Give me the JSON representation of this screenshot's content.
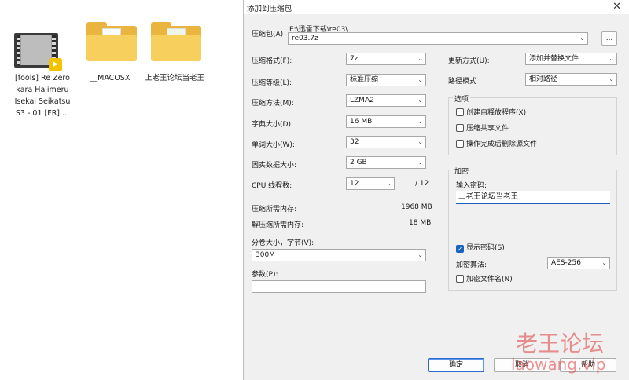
{
  "files": [
    {
      "name": "[fools] Re Zero kara Hajimeru Isekai Seikatsu S3 - 01 [FR] ...",
      "icon": "video-file-icon"
    },
    {
      "name": "__MACOSX",
      "icon": "folder-icon"
    },
    {
      "name": "上老王论坛当老王",
      "icon": "folder-icon"
    }
  ],
  "dialog": {
    "title": "添加到压缩包",
    "archive_label": "压缩包(A)",
    "archive_path": "E:\\迅雷下载\\re03\\",
    "archive_name": "re03.7z",
    "browse_label": "...",
    "left": {
      "format_label": "压缩格式(F):",
      "format_value": "7z",
      "level_label": "压缩等级(L):",
      "level_value": "标准压缩",
      "method_label": "压缩方法(M):",
      "method_value": "LZMA2",
      "dict_label": "字典大小(D):",
      "dict_value": "16 MB",
      "word_label": "单词大小(W):",
      "word_value": "32",
      "solid_label": "固实数据大小:",
      "solid_value": "2 GB",
      "cpu_label": "CPU 线程数:",
      "cpu_value": "12",
      "cpu_total": "/ 12",
      "mem_comp_label": "压缩所需内存:",
      "mem_comp_value": "1968 MB",
      "mem_decomp_label": "解压缩所需内存:",
      "mem_decomp_value": "18 MB",
      "split_label": "分卷大小，字节(V):",
      "split_value": "300M",
      "params_label": "参数(P):",
      "params_value": ""
    },
    "right": {
      "update_label": "更新方式(U):",
      "update_value": "添加并替换文件",
      "path_label": "路径模式",
      "path_value": "相对路径",
      "options_title": "选项",
      "opt_sfx": "创建自释放程序(X)",
      "opt_shared": "压缩共享文件",
      "opt_delete": "操作完成后删除源文件",
      "encrypt_title": "加密",
      "password_label": "输入密码:",
      "password_value": "上老王论坛当老王",
      "show_password": "显示密码(S)",
      "enc_method_label": "加密算法:",
      "enc_method_value": "AES-256",
      "encrypt_names": "加密文件名(N)"
    },
    "buttons": {
      "ok": "确定",
      "cancel": "取消",
      "help": "帮助"
    }
  },
  "watermark": {
    "line1": "老王论坛",
    "line2": "laowang.vip"
  }
}
